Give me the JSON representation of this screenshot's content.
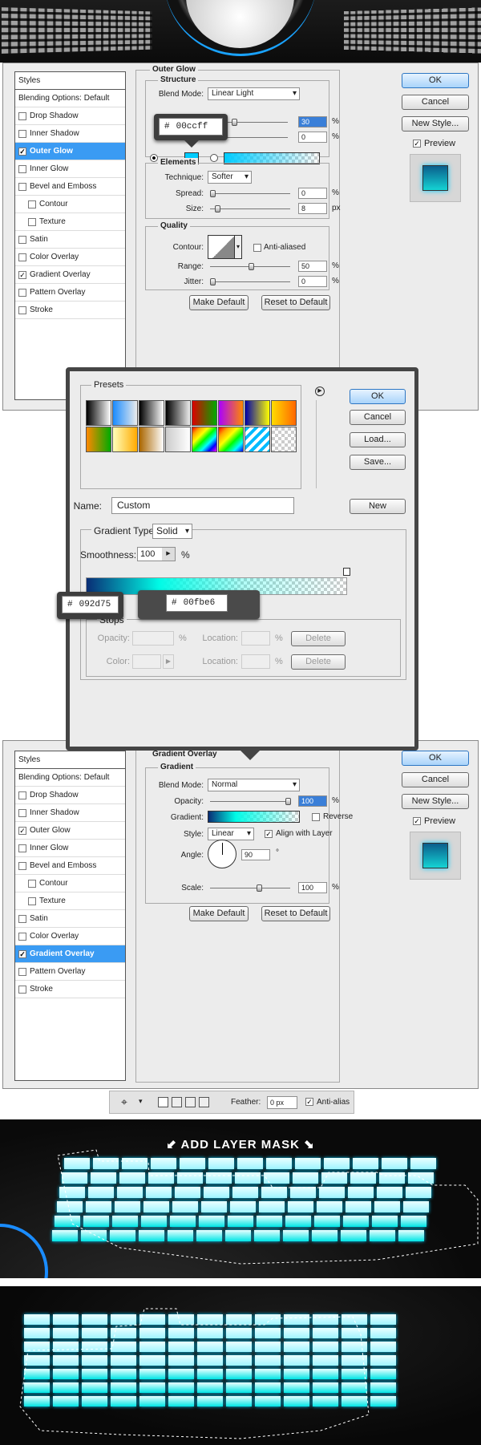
{
  "outer_glow": {
    "list_title": "Styles",
    "items": [
      {
        "label": "Blending Options: Default",
        "check": null,
        "selected": false,
        "sub": false
      },
      {
        "label": "Drop Shadow",
        "check": false,
        "selected": false,
        "sub": false
      },
      {
        "label": "Inner Shadow",
        "check": false,
        "selected": false,
        "sub": false
      },
      {
        "label": "Outer Glow",
        "check": true,
        "selected": true,
        "sub": false
      },
      {
        "label": "Inner Glow",
        "check": false,
        "selected": false,
        "sub": false
      },
      {
        "label": "Bevel and Emboss",
        "check": false,
        "selected": false,
        "sub": false
      },
      {
        "label": "Contour",
        "check": false,
        "selected": false,
        "sub": true
      },
      {
        "label": "Texture",
        "check": false,
        "selected": false,
        "sub": true
      },
      {
        "label": "Satin",
        "check": false,
        "selected": false,
        "sub": false
      },
      {
        "label": "Color Overlay",
        "check": false,
        "selected": false,
        "sub": false
      },
      {
        "label": "Gradient Overlay",
        "check": true,
        "selected": false,
        "sub": false
      },
      {
        "label": "Pattern Overlay",
        "check": false,
        "selected": false,
        "sub": false
      },
      {
        "label": "Stroke",
        "check": false,
        "selected": false,
        "sub": false
      }
    ],
    "section": "Outer Glow",
    "structure": "Structure",
    "blend_mode_label": "Blend Mode:",
    "blend_mode": "Linear Light",
    "opacity": "30",
    "noise": "0",
    "pct": "%",
    "tooltip_hash": "#",
    "tooltip_color": "00ccff",
    "elements": "Elements",
    "technique_label": "Technique:",
    "technique": "Softer",
    "spread_label": "Spread:",
    "spread": "0",
    "size_label": "Size:",
    "size": "8",
    "px": "px",
    "quality": "Quality",
    "contour_label": "Contour:",
    "anti_aliased": "Anti-aliased",
    "range_label": "Range:",
    "range": "50",
    "jitter_label": "Jitter:",
    "jitter": "0",
    "make_default": "Make Default",
    "reset_default": "Reset to Default",
    "ok": "OK",
    "cancel": "Cancel",
    "new_style": "New Style...",
    "preview": "Preview"
  },
  "gradient_editor": {
    "presets": "Presets",
    "ok": "OK",
    "cancel": "Cancel",
    "load": "Load...",
    "save": "Save...",
    "name_label": "Name:",
    "name": "Custom",
    "new": "New",
    "gradient_type_label": "Gradient Type:",
    "gradient_type": "Solid",
    "smoothness_label": "Smoothness:",
    "smoothness": "100",
    "pct": "%",
    "stop1_hash": "#",
    "stop1_color": "092d75",
    "stop2_hash": "#",
    "stop2_color": "00fbe6",
    "stops": "Stops",
    "opacity_label": "Opacity:",
    "location_label": "Location:",
    "color_label": "Color:",
    "delete": "Delete"
  },
  "gradient_overlay": {
    "list_title": "Styles",
    "items": [
      {
        "label": "Blending Options: Default",
        "check": null,
        "selected": false,
        "sub": false
      },
      {
        "label": "Drop Shadow",
        "check": false,
        "selected": false,
        "sub": false
      },
      {
        "label": "Inner Shadow",
        "check": false,
        "selected": false,
        "sub": false
      },
      {
        "label": "Outer Glow",
        "check": true,
        "selected": false,
        "sub": false
      },
      {
        "label": "Inner Glow",
        "check": false,
        "selected": false,
        "sub": false
      },
      {
        "label": "Bevel and Emboss",
        "check": false,
        "selected": false,
        "sub": false
      },
      {
        "label": "Contour",
        "check": false,
        "selected": false,
        "sub": true
      },
      {
        "label": "Texture",
        "check": false,
        "selected": false,
        "sub": true
      },
      {
        "label": "Satin",
        "check": false,
        "selected": false,
        "sub": false
      },
      {
        "label": "Color Overlay",
        "check": false,
        "selected": false,
        "sub": false
      },
      {
        "label": "Gradient Overlay",
        "check": true,
        "selected": true,
        "sub": false
      },
      {
        "label": "Pattern Overlay",
        "check": false,
        "selected": false,
        "sub": false
      },
      {
        "label": "Stroke",
        "check": false,
        "selected": false,
        "sub": false
      }
    ],
    "section": "Gradient Overlay",
    "sub": "Gradient",
    "blend_mode_label": "Blend Mode:",
    "blend_mode": "Normal",
    "opacity_label": "Opacity:",
    "opacity": "100",
    "pct": "%",
    "gradient_label": "Gradient:",
    "reverse": "Reverse",
    "style_label": "Style:",
    "style": "Linear",
    "align": "Align with Layer",
    "angle_label": "Angle:",
    "angle": "90",
    "deg": "°",
    "scale_label": "Scale:",
    "scale": "100",
    "make_default": "Make Default",
    "reset_default": "Reset to Default",
    "ok": "OK",
    "cancel": "Cancel",
    "new_style": "New Style...",
    "preview": "Preview"
  },
  "toolbar": {
    "feather_label": "Feather:",
    "feather": "0 px",
    "anti_alias": "Anti-alias"
  },
  "banner": {
    "text": "ADD LAYER MASK"
  },
  "colors": {
    "glow": "#00ccff",
    "stop1": "#092d75",
    "stop2": "#00fbe6",
    "accent": "#3a9bf3"
  }
}
